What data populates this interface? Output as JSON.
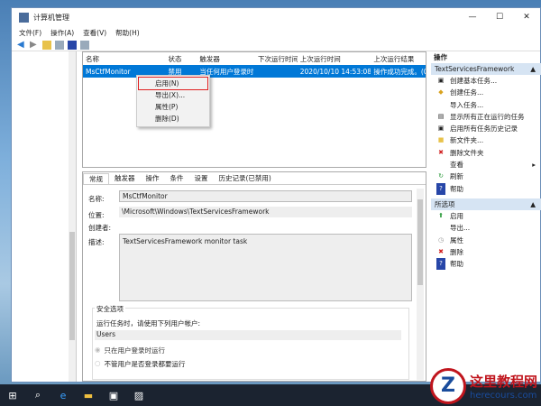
{
  "window": {
    "title": "计算机管理",
    "min": "—",
    "max": "☐",
    "close": "✕"
  },
  "menu": [
    "文件(F)",
    "操作(A)",
    "查看(V)",
    "帮助(H)"
  ],
  "list": {
    "headers": [
      "名称",
      "状态",
      "触发器",
      "下次运行时间",
      "上次运行时间",
      "上次运行结果"
    ],
    "row": [
      "MsCtfMonitor",
      "禁用",
      "当任何用户登录时",
      "",
      "2020/10/10 14:53:08",
      "操作成功完成。(0x"
    ]
  },
  "context_menu": [
    "启用(N)",
    "导出(X)...",
    "属性(P)",
    "删除(D)"
  ],
  "detail": {
    "tabs": [
      "常规",
      "触发器",
      "操作",
      "条件",
      "设置",
      "历史记录(已禁用)"
    ],
    "name_label": "名称:",
    "name": "MsCtfMonitor",
    "location_label": "位置:",
    "location": "\\Microsoft\\Windows\\TextServicesFramework",
    "author_label": "创建者:",
    "desc_label": "描述:",
    "desc": "TextServicesFramework monitor task",
    "security_title": "安全选项",
    "security_prompt": "运行任务时，请使用下列用户帐户:",
    "user": "Users",
    "radio1": "只在用户登录时运行",
    "radio2": "不管用户是否登录都要运行"
  },
  "actions": {
    "title": "操作",
    "group1": "TextServicesFramework",
    "items1": [
      "创建基本任务...",
      "创建任务...",
      "导入任务...",
      "显示所有正在运行的任务",
      "启用所有任务历史记录",
      "新文件夹...",
      "删除文件夹",
      "查看",
      "刷新",
      "帮助"
    ],
    "group2": "所选项",
    "items2": [
      "启用",
      "导出...",
      "属性",
      "删除",
      "帮助"
    ]
  },
  "watermark": {
    "name": "这里教程网",
    "url": "herecours.com"
  }
}
